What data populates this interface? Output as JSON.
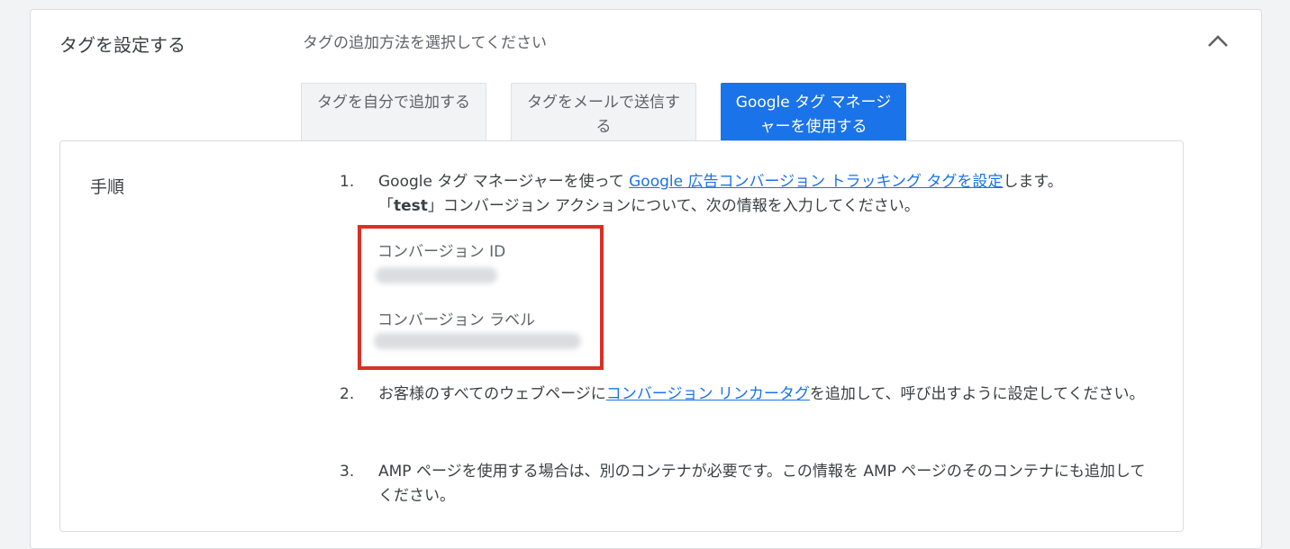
{
  "header": {
    "title": "タグを設定する",
    "subtitle": "タグの追加方法を選択してください"
  },
  "tabs": [
    {
      "label": "タグを自分で追加する",
      "active": false
    },
    {
      "label": "タグをメールで送信する",
      "active": false
    },
    {
      "label": "Google タグ マネージャーを使用する",
      "active": true
    }
  ],
  "steps_label": "手順",
  "step1": {
    "number": "1.",
    "text_before": "Google タグ マネージャーを使って ",
    "link": "Google 広告コンバージョン トラッキング タグを設定",
    "text_after": "します。",
    "line2_open": "「",
    "line2_bold": "test",
    "line2_rest": "」コンバージョン アクションについて、次の情報を入力してください。"
  },
  "fields": {
    "conversion_id_label": "コンバージョン ID",
    "conversion_label_label": "コンバージョン ラベル"
  },
  "step2": {
    "number": "2.",
    "text_before": "お客様のすべてのウェブページに",
    "link": "コンバージョン リンカータグ",
    "text_after": "を追加して、呼び出すように設定してください。"
  },
  "step3": {
    "number": "3.",
    "text": "AMP ページを使用する場合は、別のコンテナが必要です。この情報を AMP ページのそのコンテナにも追加してください。"
  },
  "colors": {
    "accent": "#1a73e8",
    "highlight": "#d93025"
  },
  "icons": {
    "collapse": "chevron-up-icon"
  }
}
